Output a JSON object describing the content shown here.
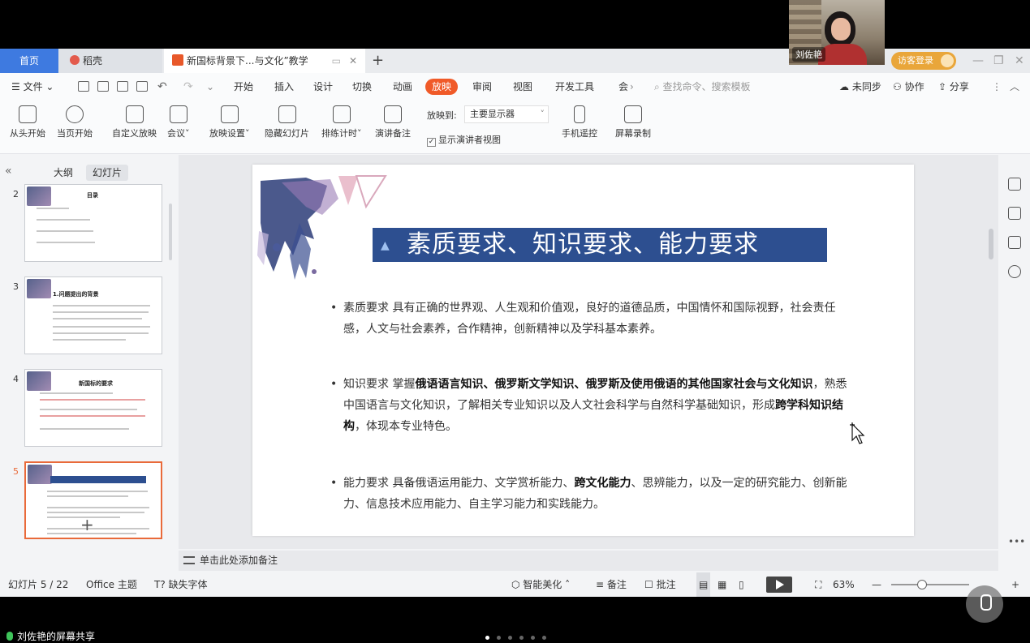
{
  "video": {
    "name": "刘佐艳"
  },
  "tabs": {
    "home": "首页",
    "daoke": "稻壳",
    "doc": "新国标背景下...与文化”教学",
    "add": "+"
  },
  "guest_label": "访客登录",
  "window_controls": {
    "min": "—",
    "restore": "❐",
    "close": "✕"
  },
  "menu": {
    "file": "文件",
    "items": [
      "开始",
      "插入",
      "设计",
      "切换",
      "动画",
      "放映",
      "审阅",
      "视图",
      "开发工具",
      "会"
    ],
    "active": "放映",
    "search_placeholder": "查找命令、搜索模板",
    "sync": "未同步",
    "collab": "协作",
    "share": "分享"
  },
  "ribbon": {
    "buttons": [
      "从头开始",
      "当页开始",
      "自定义放映",
      "会议",
      "放映设置",
      "隐藏幻灯片",
      "排练计时",
      "演讲备注",
      "手机遥控",
      "屏幕录制"
    ],
    "play_to_label": "放映到:",
    "play_to_value": "主要显示器",
    "presenter_view": "显示演讲者视图",
    "presenter_view_checked": true
  },
  "left_pane": {
    "tabs": [
      "大纲",
      "幻灯片"
    ],
    "active_tab": "幻灯片",
    "thumbs": [
      {
        "num": "2",
        "title": "目录"
      },
      {
        "num": "3",
        "title": "1.问题提出的背景"
      },
      {
        "num": "4",
        "title": "新国标的要求"
      },
      {
        "num": "5",
        "title": "素质要求、知识要求、能力要求"
      }
    ],
    "selected": "5"
  },
  "slide": {
    "title": "素质要求、知识要求、能力要求",
    "p1_text": "素质要求 具有正确的世界观、人生观和价值观，良好的道德品质，中国情怀和国际视野，社会责任感，人文与社会素养，合作精神，创新精神以及学科基本素养。",
    "p2_a": "知识要求 掌握",
    "p2_b": "俄语语言知识、俄罗斯文学知识、俄罗斯及使用俄语的其他国家社会与文化知识",
    "p2_c": "，熟悉中国语言与文化知识，了解相关专业知识以及人文社会科学与自然科学基础知识，形成",
    "p2_d": "跨学科知识结构",
    "p2_e": "，体现本专业特色。",
    "p3_a": "能力要求 具备俄语运用能力、文学赏析能力、",
    "p3_b": "跨文化能力",
    "p3_c": "、思辨能力，以及一定的研究能力、创新能力、信息技术应用能力、自主学习能力和实践能力。"
  },
  "notes_placeholder": "单击此处添加备注",
  "status": {
    "slide_info": "幻灯片 5 / 22",
    "theme": "Office 主题",
    "missing_font": "缺失字体",
    "beautify": "智能美化",
    "notes": "备注",
    "comments": "批注",
    "zoom": "63%"
  },
  "screen_share": "刘佐艳的屏幕共享",
  "colors": {
    "accent": "#f05a28",
    "banner": "#2d4f90",
    "home_tab": "#3e7ae0"
  }
}
